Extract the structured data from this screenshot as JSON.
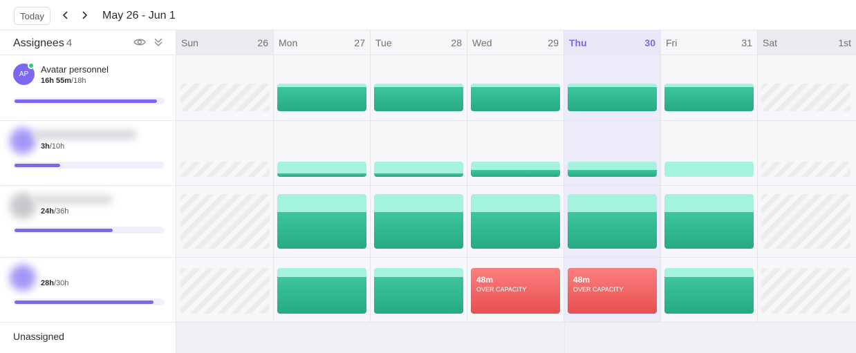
{
  "toolbar": {
    "today_label": "Today",
    "range_label": "May 26 - Jun 1"
  },
  "sidebar": {
    "title": "Assignees",
    "count": "4",
    "unassigned_label": "Unassigned"
  },
  "days": [
    {
      "name": "Sun",
      "num": "26",
      "weekend": true
    },
    {
      "name": "Mon",
      "num": "27"
    },
    {
      "name": "Tue",
      "num": "28"
    },
    {
      "name": "Wed",
      "num": "29"
    },
    {
      "name": "Thu",
      "num": "30",
      "today": true
    },
    {
      "name": "Fri",
      "num": "31"
    },
    {
      "name": "Sat",
      "num": "1st",
      "weekend": true
    }
  ],
  "assignees": [
    {
      "initials": "AP",
      "name": "Avatar personnel",
      "hours_used": "16h 55m",
      "hours_total": "18h",
      "progress": 0.94,
      "online": true
    },
    {
      "initials": "",
      "name": "",
      "hours_used": "3h",
      "hours_total": "10h",
      "progress": 0.3
    },
    {
      "initials": "",
      "name": "",
      "hours_used": "24h",
      "hours_total": "36h",
      "progress": 0.65
    },
    {
      "initials": "",
      "name": "",
      "hours_used": "28h",
      "hours_total": "30h",
      "progress": 0.92
    }
  ],
  "over_capacity": {
    "amount": "48m",
    "label": "OVER CAPACITY"
  },
  "colors": {
    "accent": "#7b68ee",
    "scheduled": "#2fb68e",
    "capacity": "#a5f3df",
    "over": "#ef5b5b",
    "online": "#2ecc71"
  }
}
